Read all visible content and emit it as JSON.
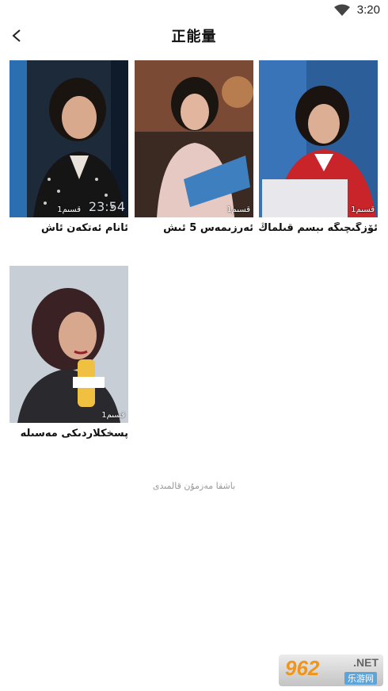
{
  "status": {
    "time": "3:20"
  },
  "header": {
    "title": "正能量"
  },
  "videos": [
    {
      "caption": "ئانام ئەتكەن ئاش",
      "count": "1قسىم",
      "timestamp": "23:54"
    },
    {
      "caption": "ئەرزىمەس 5 ئىش",
      "count": "1قسىم"
    },
    {
      "caption": "ئۆزگىچىگە ىبسم قىلماڭ",
      "count": "1قسىم"
    },
    {
      "caption": "پسخكلاردىكى مەسىلە",
      "count": "1قسىم"
    }
  ],
  "footer": {
    "end_text": "باشقا مەزمۇن قالمىدى"
  },
  "watermark": {
    "logo": "962",
    "net": ".NET",
    "sub": "乐游网"
  },
  "colors": {
    "accent": "#f08a00",
    "muted": "#999999"
  }
}
